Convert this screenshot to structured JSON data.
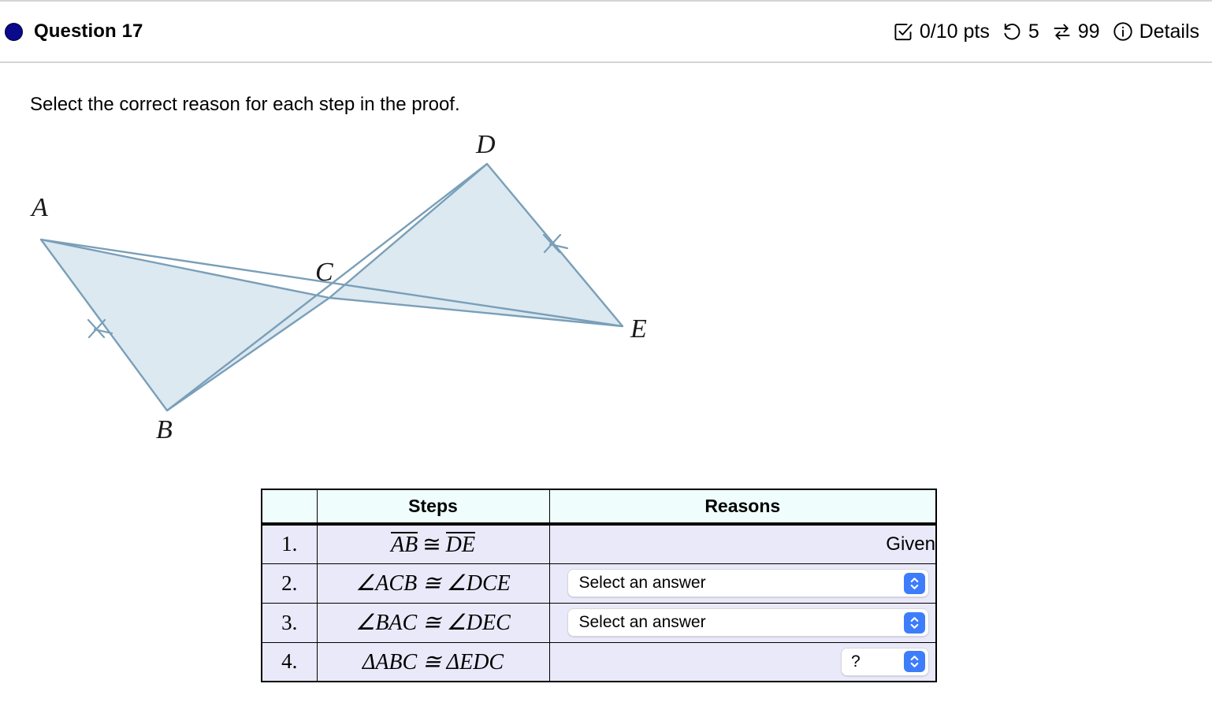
{
  "header": {
    "question_label": "Question 17",
    "bullet_color": "#0a0a8c",
    "points": "0/10 pts",
    "attempts": "5",
    "versions": "99",
    "details_label": "Details",
    "icons": {
      "points": "checkbox-check-icon",
      "attempts": "undo-arrow-icon",
      "versions": "swap-arrows-icon",
      "details": "info-circle-icon"
    }
  },
  "prompt": "Select the correct reason for each step in the proof.",
  "figure": {
    "labels": [
      "A",
      "B",
      "C",
      "D",
      "E"
    ],
    "fill_color": "#dce9f1",
    "stroke_color": "#7a9fb8",
    "tick_marks": [
      "AB",
      "DE"
    ]
  },
  "table": {
    "headers": {
      "blank": "",
      "steps": "Steps",
      "reasons": "Reasons"
    },
    "header_bg": "#effdfd",
    "row_bg": "#e9e9f9",
    "rows": [
      {
        "num": "1.",
        "step_left_over": "AB",
        "step_rel": "≅",
        "step_right_over": "DE",
        "step_kind": "segments",
        "reason_type": "text",
        "reason_text": "Given"
      },
      {
        "num": "2.",
        "step_text": "∠ACB ≅ ∠DCE",
        "step_kind": "plain",
        "reason_type": "select",
        "reason_text": "Select an answer",
        "select_size": "wide"
      },
      {
        "num": "3.",
        "step_text": "∠BAC ≅ ∠DEC",
        "step_kind": "plain",
        "reason_type": "select",
        "reason_text": "Select an answer",
        "select_size": "wide"
      },
      {
        "num": "4.",
        "step_text": "ΔABC ≅ ΔEDC",
        "step_kind": "plain",
        "reason_type": "select",
        "reason_text": "?",
        "select_size": "small"
      }
    ]
  }
}
